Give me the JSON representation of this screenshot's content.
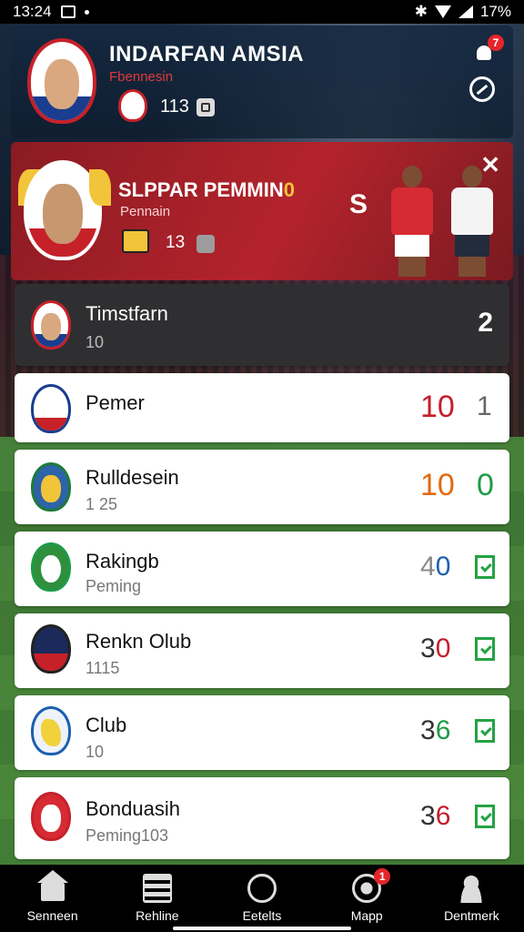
{
  "status_bar": {
    "time": "13:24",
    "battery": "17%"
  },
  "header": {
    "title": "INDARFAN AMSIA",
    "subtitle": "Fbennesin",
    "count": "113",
    "notification_count": "7"
  },
  "promo": {
    "title": "SLPPAR PEMMIN",
    "title_badge": "0",
    "subtitle": "Pennain",
    "count": "13",
    "swap_label": "S",
    "close_label": "✕"
  },
  "list": [
    {
      "name": "Timstfarn",
      "sub": "10",
      "score": "2",
      "pts": "",
      "score_color": "#ffffff",
      "active": true
    },
    {
      "name": "Pemer",
      "sub": "",
      "score": "10",
      "pts": "1",
      "score_color": "#c41e2a"
    },
    {
      "name": "Rulldesein",
      "sub": "1 25",
      "score": "10",
      "pts": "0",
      "score_color": "#e06a10",
      "pts_color": "#1e9a48"
    },
    {
      "name": "Rakingb",
      "sub": "Peming",
      "score": "4",
      "score2": "0",
      "score_color": "#888888",
      "score2_color": "#1c5fb0"
    },
    {
      "name": "Renkn Olub",
      "sub": "1115",
      "score": "3",
      "score2": "0",
      "score_color": "#333333",
      "score2_color": "#c41e2a"
    },
    {
      "name": "Club",
      "sub": "10",
      "score": "3",
      "score2": "6",
      "score_color": "#333333",
      "score2_color": "#1e9a48"
    },
    {
      "name": "Bonduasih",
      "sub": "Peming103",
      "score": "3",
      "score2": "6",
      "score_color": "#333333",
      "score2_color": "#c41e2a"
    }
  ],
  "tabs": [
    {
      "label": "Senneen",
      "icon": "home-icon"
    },
    {
      "label": "Rehline",
      "icon": "list-icon"
    },
    {
      "label": "Eetelts",
      "icon": "circle-icon"
    },
    {
      "label": "Mapp",
      "icon": "map-icon",
      "badge": "1"
    },
    {
      "label": "Dentmerk",
      "icon": "user-icon"
    }
  ]
}
